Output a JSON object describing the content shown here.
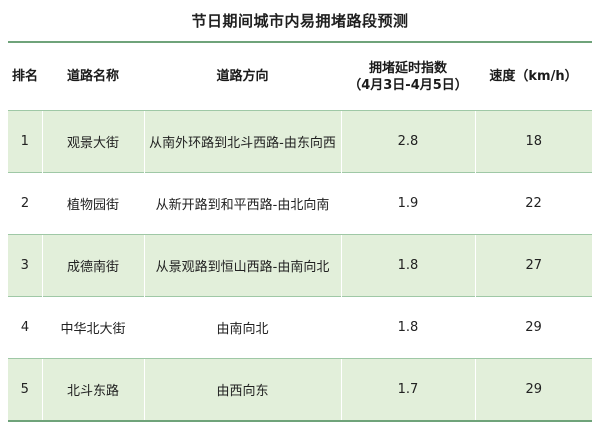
{
  "title": "节日期间城市内易拥堵路段预测",
  "headers": {
    "rank": "排名",
    "road_name": "道路名称",
    "direction": "道路方向",
    "index_line1": "拥堵延时指数",
    "index_line2": "（4月3日-4月5日）",
    "speed": "速度（km/h）"
  },
  "rows": [
    {
      "rank": "1",
      "road_name": "观景大街",
      "direction": "从南外环路到北斗西路-由东向西",
      "index": "2.8",
      "speed": "18"
    },
    {
      "rank": "2",
      "road_name": "植物园街",
      "direction": "从新开路到和平西路-由北向南",
      "index": "1.9",
      "speed": "22"
    },
    {
      "rank": "3",
      "road_name": "成德南街",
      "direction": "从景观路到恒山西路-由南向北",
      "index": "1.8",
      "speed": "27"
    },
    {
      "rank": "4",
      "road_name": "中华北大街",
      "direction": "由南向北",
      "index": "1.8",
      "speed": "29"
    },
    {
      "rank": "5",
      "road_name": "北斗东路",
      "direction": "由西向东",
      "index": "1.7",
      "speed": "29"
    }
  ],
  "colors": {
    "row_shade": "#e2efda",
    "rule": "#6fa37a",
    "row_divider": "#9fc8a6"
  }
}
